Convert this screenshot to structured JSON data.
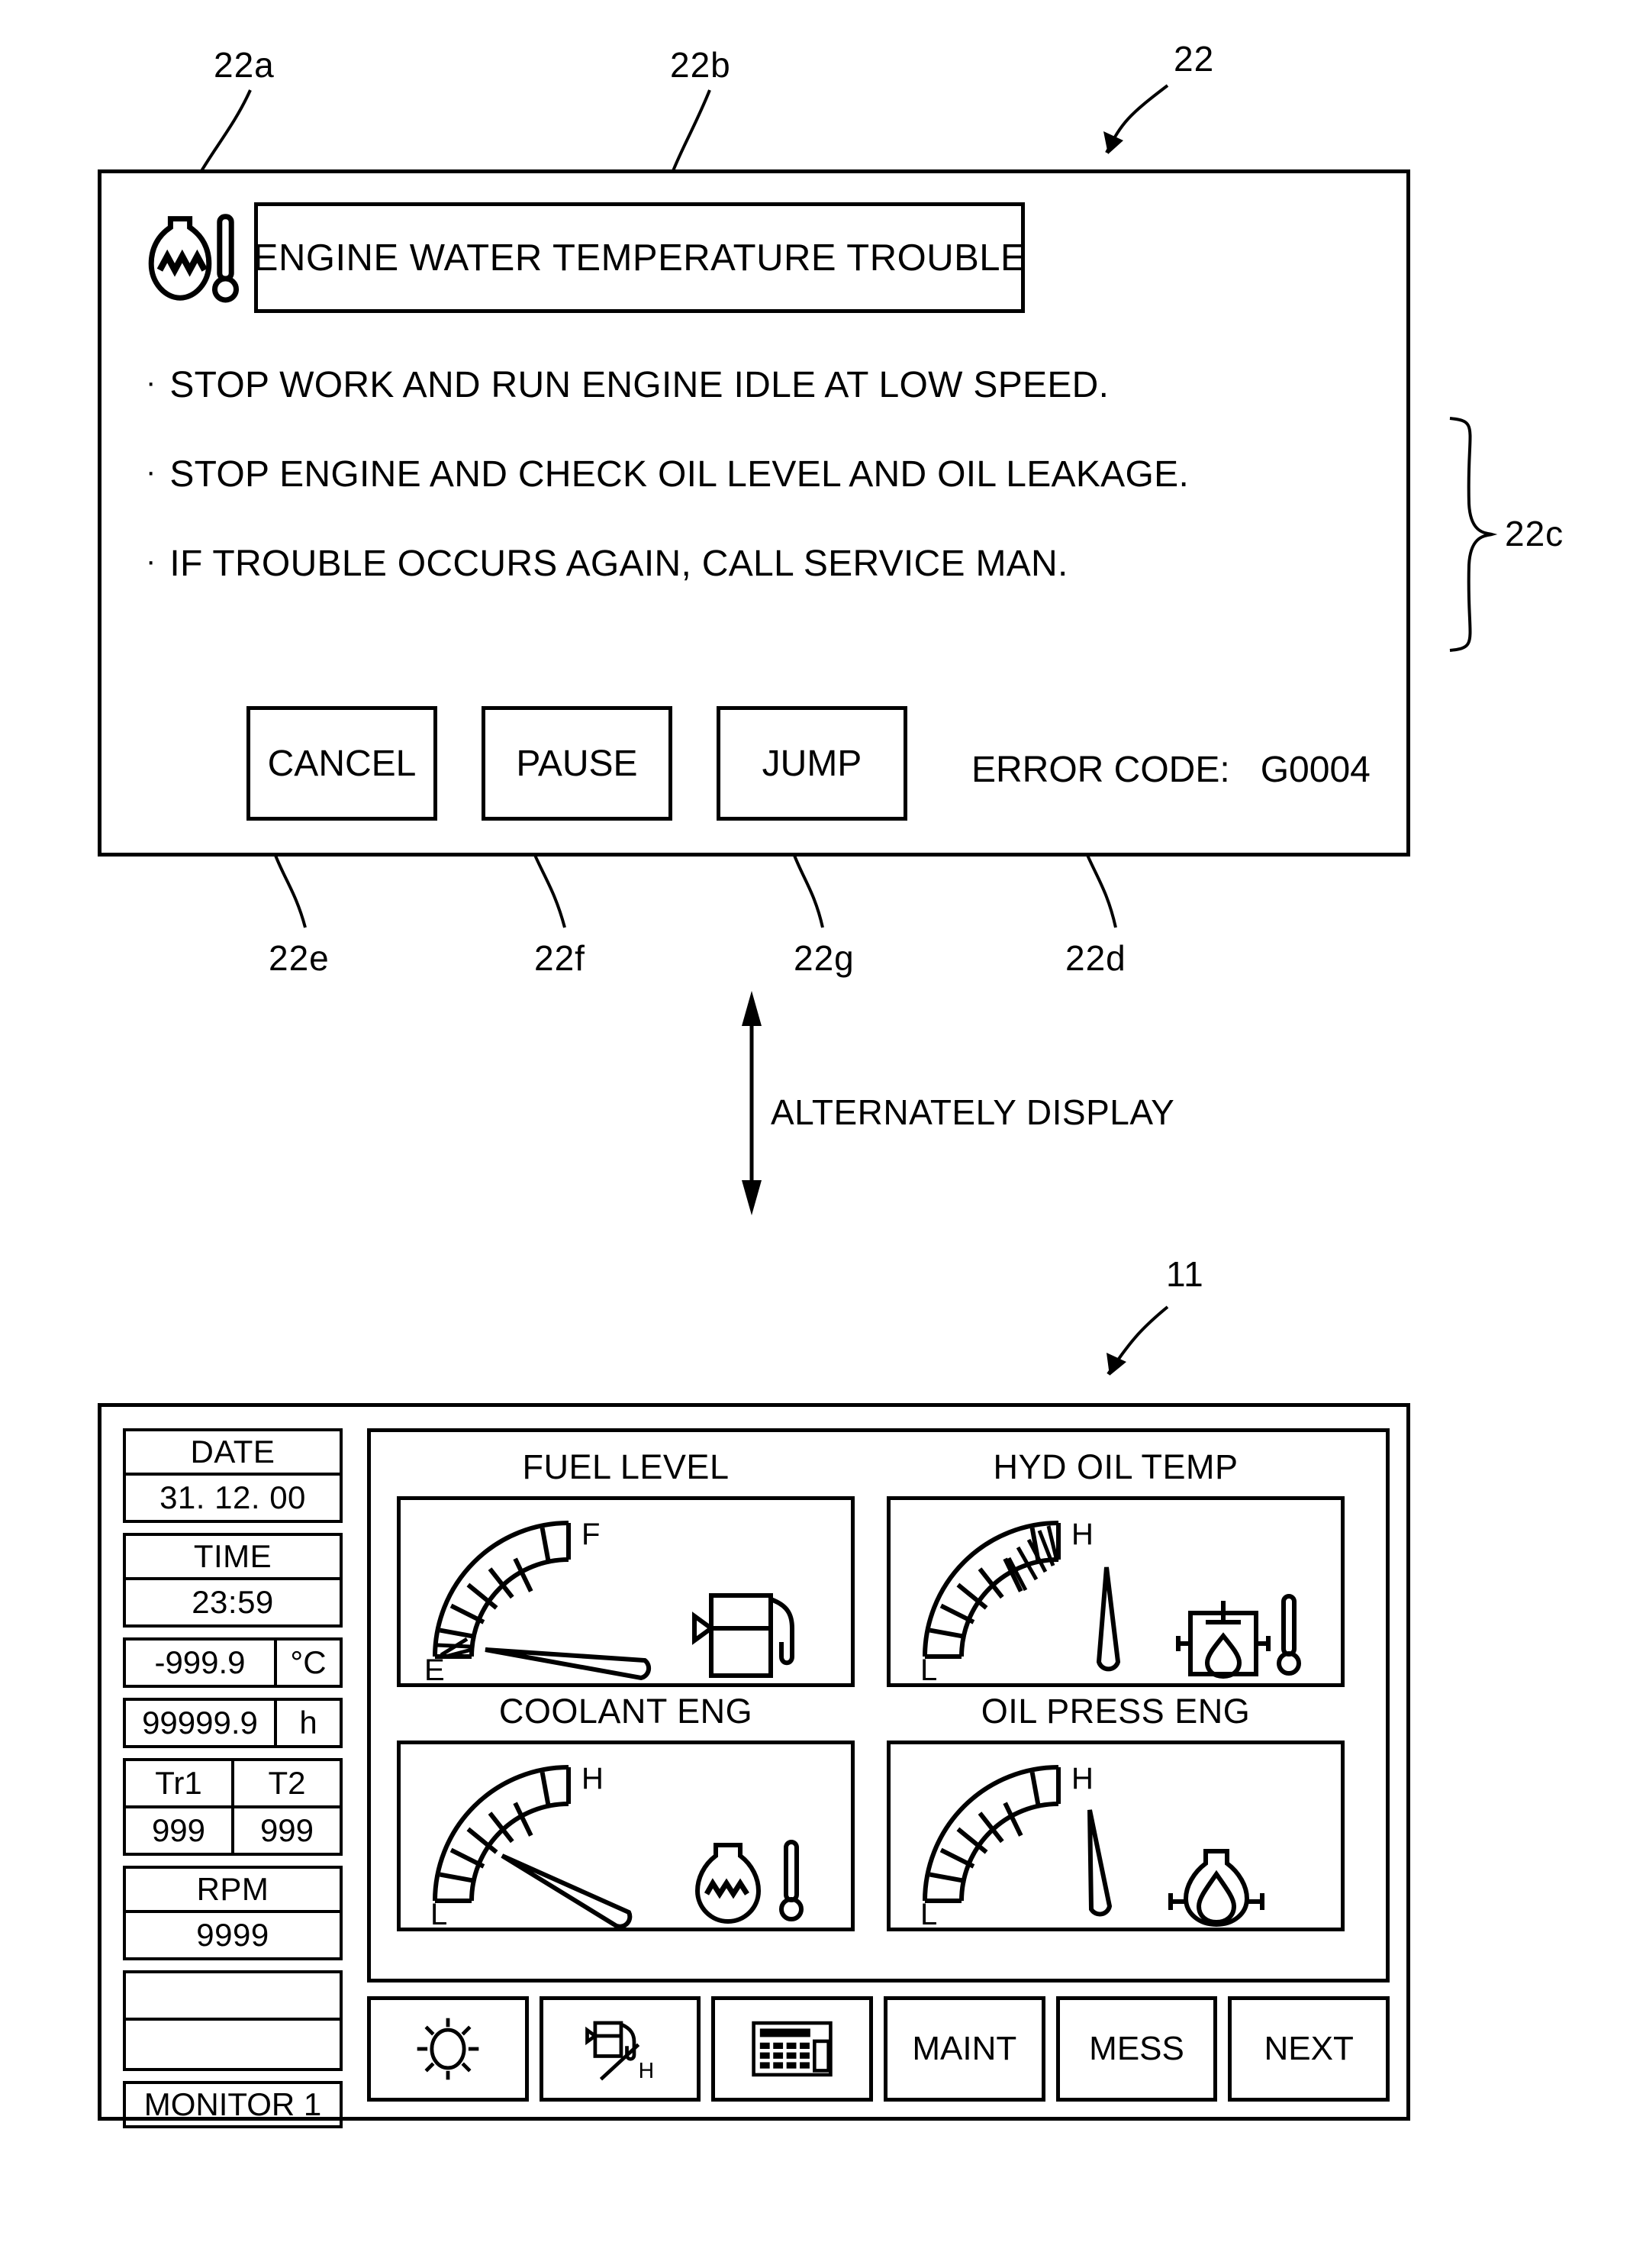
{
  "figure": {
    "refs": {
      "dialog": "22",
      "dialog_icon": "22a",
      "dialog_title": "22b",
      "dialog_instructions": "22c",
      "dialog_error_code": "22d",
      "dialog_cancel": "22e",
      "dialog_pause": "22f",
      "dialog_jump": "22g",
      "monitor": "11"
    },
    "transition_label": "ALTERNATELY DISPLAY"
  },
  "trouble_dialog": {
    "icon_name": "engine-water-temperature-icon",
    "title": "ENGINE WATER TEMPERATURE TROUBLE",
    "instructions": [
      "STOP WORK AND RUN ENGINE IDLE AT LOW SPEED.",
      "STOP ENGINE AND CHECK OIL LEVEL AND OIL LEAKAGE.",
      "IF TROUBLE OCCURS AGAIN, CALL SERVICE MAN."
    ],
    "bullet": "·",
    "buttons": [
      {
        "label": "CANCEL"
      },
      {
        "label": "PAUSE"
      },
      {
        "label": "JUMP"
      }
    ],
    "error_code_label": "ERROR CODE:",
    "error_code_value": "G0004"
  },
  "monitor": {
    "sidebar": {
      "date_label": "DATE",
      "date_value": "31. 12. 00",
      "time_label": "TIME",
      "time_value": "23:59",
      "temp_value": "-999.9",
      "temp_unit": "°C",
      "hours_value": "99999.9",
      "hours_unit": "h",
      "tr1_label": "Tr1",
      "t2_label": "T2",
      "tr1_value": "999",
      "t2_value": "999",
      "rpm_label": "RPM",
      "rpm_value": "9999",
      "blank_top": "",
      "blank_bottom": "",
      "monitor_label": "MONITOR 1"
    },
    "gauges": [
      {
        "title": "FUEL LEVEL",
        "high_label": "F",
        "low_label": "E",
        "icon_name": "fuel-pump-icon",
        "needle_angle_deg": 178,
        "warn_zone": "low",
        "warn_segments": 1
      },
      {
        "title": "HYD OIL TEMP",
        "high_label": "H",
        "low_label": "L",
        "icon_name": "hydraulic-oil-thermometer-icon",
        "needle_angle_deg": 90,
        "warn_zone": "high",
        "warn_segments": 3
      },
      {
        "title": "COOLANT ENG",
        "high_label": "H",
        "low_label": "L",
        "icon_name": "engine-coolant-thermometer-icon",
        "needle_angle_deg": 147,
        "warn_zone": "none",
        "warn_segments": 0
      },
      {
        "title": "OIL PRESS ENG",
        "high_label": "H",
        "low_label": "L",
        "icon_name": "engine-oil-pressure-icon",
        "needle_angle_deg": 90,
        "warn_zone": "none",
        "warn_segments": 0
      }
    ],
    "toolbar": [
      {
        "label": "",
        "icon_name": "brightness-sun-icon"
      },
      {
        "label": "",
        "icon_name": "fuel-consumption-per-hour-icon"
      },
      {
        "label": "",
        "icon_name": "keypad-panel-icon"
      },
      {
        "label": "MAINT",
        "icon_name": ""
      },
      {
        "label": "MESS",
        "icon_name": ""
      },
      {
        "label": "NEXT",
        "icon_name": ""
      }
    ]
  }
}
